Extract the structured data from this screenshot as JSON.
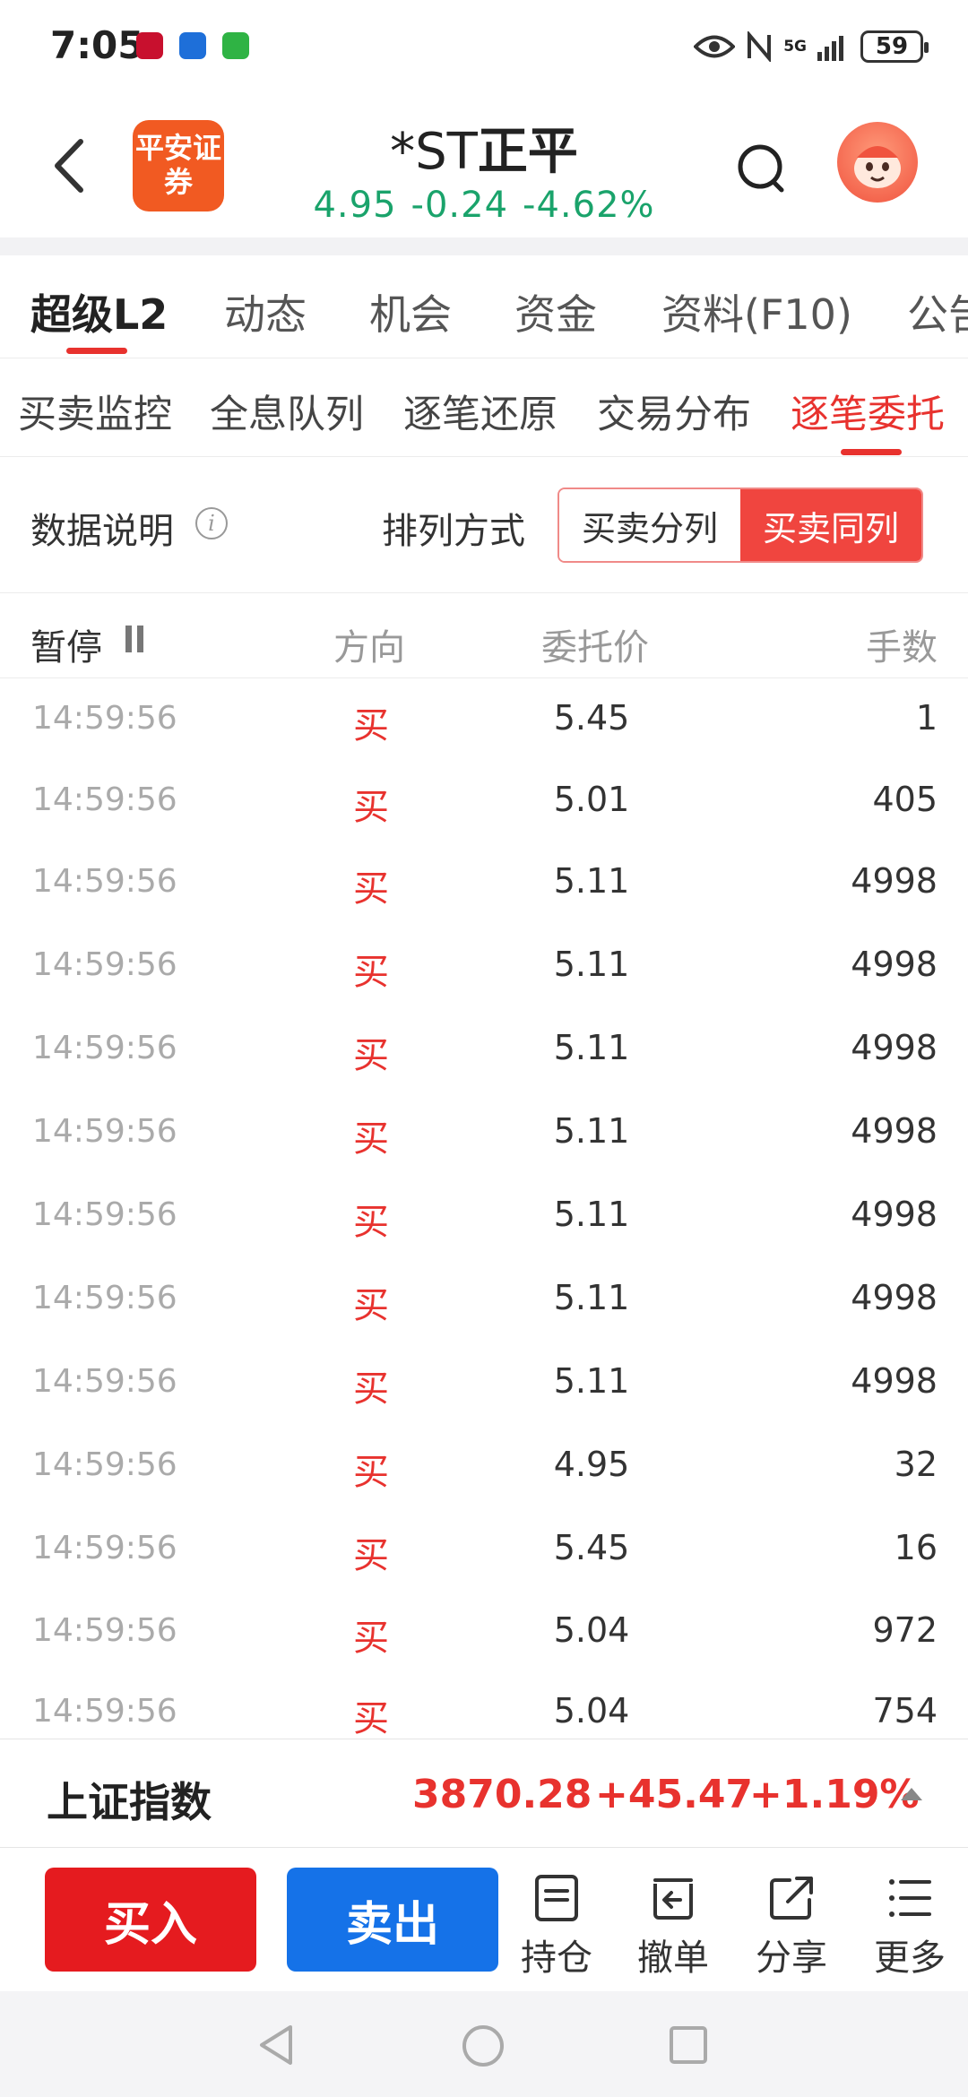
{
  "status_bar": {
    "time": "7:05",
    "network": "5G",
    "battery": "59",
    "icons": [
      "app-notification-icon-1",
      "app-notification-icon-2",
      "phone-icon",
      "eye-icon",
      "nfc-icon",
      "signal-icon",
      "battery-icon"
    ]
  },
  "header": {
    "logo_text": "平安证券",
    "stock_prefix": "*ST",
    "stock_name": "正平",
    "price": "4.95",
    "change": "-0.24",
    "change_pct": "-4.62%",
    "colors": {
      "down": "#1aa36b",
      "up": "#e8322e",
      "logo": "#f15a22"
    }
  },
  "tabs": [
    {
      "label": "超级L2",
      "active": true
    },
    {
      "label": "动态"
    },
    {
      "label": "机会"
    },
    {
      "label": "资金"
    },
    {
      "label": "资料(F10)"
    },
    {
      "label": "公告"
    }
  ],
  "subtabs": [
    {
      "label": "买卖监控"
    },
    {
      "label": "全息队列"
    },
    {
      "label": "逐笔还原"
    },
    {
      "label": "交易分布"
    },
    {
      "label": "逐笔委托",
      "active": true
    }
  ],
  "options": {
    "data_desc": "数据说明",
    "sort_label": "排列方式",
    "seg_separate": "买卖分列",
    "seg_same": "买卖同列"
  },
  "table": {
    "headers": {
      "pause": "暂停",
      "direction": "方向",
      "price": "委托价",
      "volume": "手数"
    },
    "rows": [
      {
        "time": "14:59:56",
        "dir": "买",
        "price": "5.45",
        "vol": "1"
      },
      {
        "time": "14:59:56",
        "dir": "买",
        "price": "5.01",
        "vol": "405"
      },
      {
        "time": "14:59:56",
        "dir": "买",
        "price": "5.11",
        "vol": "4998"
      },
      {
        "time": "14:59:56",
        "dir": "买",
        "price": "5.11",
        "vol": "4998"
      },
      {
        "time": "14:59:56",
        "dir": "买",
        "price": "5.11",
        "vol": "4998"
      },
      {
        "time": "14:59:56",
        "dir": "买",
        "price": "5.11",
        "vol": "4998"
      },
      {
        "time": "14:59:56",
        "dir": "买",
        "price": "5.11",
        "vol": "4998"
      },
      {
        "time": "14:59:56",
        "dir": "买",
        "price": "5.11",
        "vol": "4998"
      },
      {
        "time": "14:59:56",
        "dir": "买",
        "price": "5.11",
        "vol": "4998"
      },
      {
        "time": "14:59:56",
        "dir": "买",
        "price": "4.95",
        "vol": "32"
      },
      {
        "time": "14:59:56",
        "dir": "买",
        "price": "5.45",
        "vol": "16"
      },
      {
        "time": "14:59:56",
        "dir": "买",
        "price": "5.04",
        "vol": "972"
      },
      {
        "time": "14:59:56",
        "dir": "买",
        "price": "5.04",
        "vol": "754"
      }
    ]
  },
  "index_bar": {
    "name": "上证指数",
    "value": "3870.28",
    "change": "+45.47",
    "change_pct": "+1.19%"
  },
  "actions": {
    "buy": "买入",
    "sell": "卖出",
    "position": "持仓",
    "cancel": "撤单",
    "share": "分享",
    "more": "更多"
  }
}
